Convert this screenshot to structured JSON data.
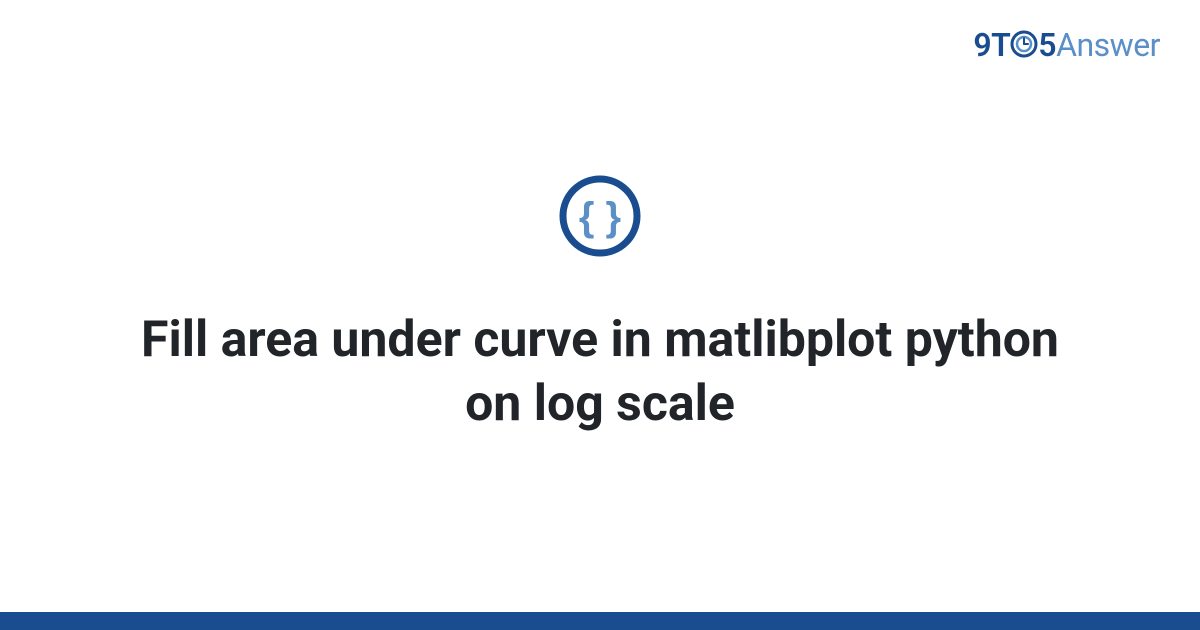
{
  "logo": {
    "part1": "9T",
    "part2": "5",
    "part3": "Answer"
  },
  "icon": {
    "name": "code-braces-icon"
  },
  "title": "Fill area under curve in matlibplot python on log scale",
  "colors": {
    "brand_dark": "#1a4d8f",
    "brand_light": "#5a8fc7",
    "text": "#212529"
  }
}
